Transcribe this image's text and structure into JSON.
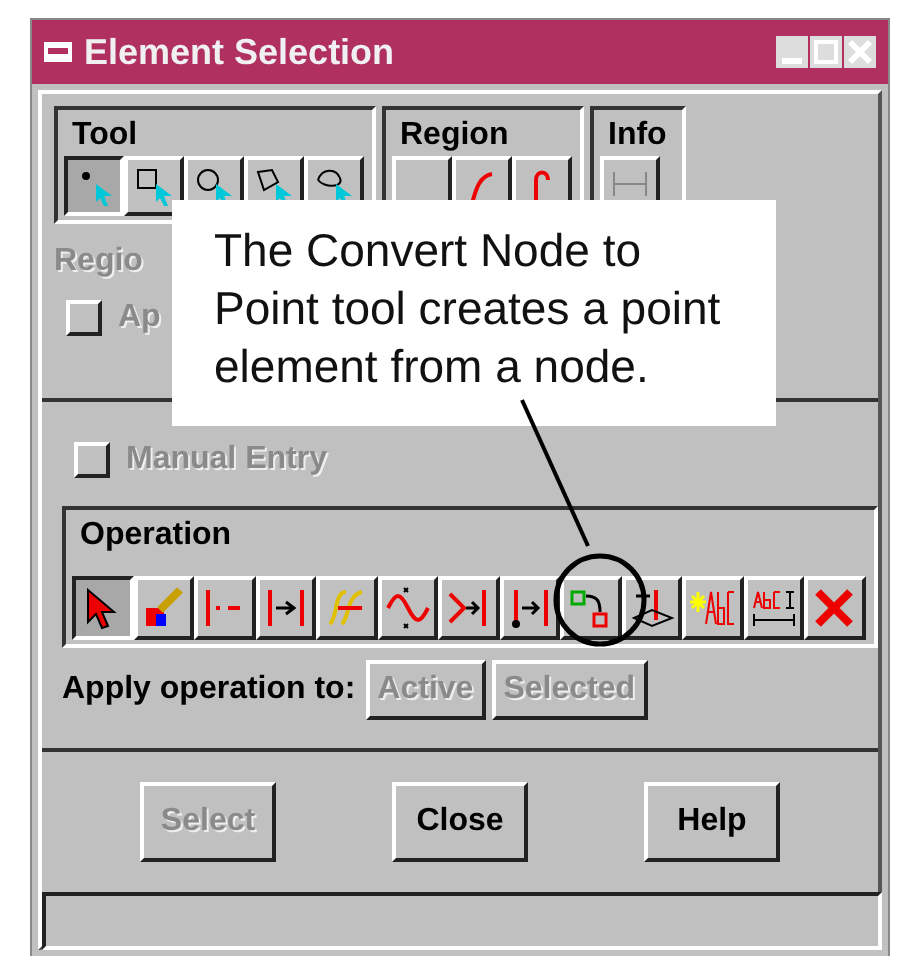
{
  "window": {
    "title": "Element Selection"
  },
  "tool_group": {
    "label": "Tool",
    "tools": [
      {
        "kind": "point",
        "selected": true
      },
      {
        "kind": "box",
        "selected": false
      },
      {
        "kind": "circle",
        "selected": false
      },
      {
        "kind": "polygon",
        "selected": false
      },
      {
        "kind": "freehand",
        "selected": false
      }
    ]
  },
  "region_group": {
    "label": "Region",
    "tools": [
      {
        "kind": "blank"
      },
      {
        "kind": "curve"
      },
      {
        "kind": "hook"
      }
    ]
  },
  "info_group": {
    "label": "Info"
  },
  "region_label": {
    "text": "Regio",
    "disabled": true
  },
  "apply_checkbox": {
    "label": "Ap",
    "checked": false,
    "disabled": true
  },
  "manual_entry": {
    "label": "Manual Entry",
    "checked": false,
    "disabled": true
  },
  "operation": {
    "label": "Operation",
    "tools": [
      {
        "kind": "select",
        "selected": true
      },
      {
        "kind": "paint",
        "selected": false
      },
      {
        "kind": "split",
        "selected": false
      },
      {
        "kind": "extend",
        "selected": false
      },
      {
        "kind": "curve",
        "selected": false
      },
      {
        "kind": "wave",
        "selected": false
      },
      {
        "kind": "join",
        "selected": false
      },
      {
        "kind": "connect",
        "selected": false
      },
      {
        "kind": "convert",
        "selected": false
      },
      {
        "kind": "project",
        "selected": false
      },
      {
        "kind": "label",
        "selected": false
      },
      {
        "kind": "dimension",
        "selected": false
      },
      {
        "kind": "delete",
        "selected": false
      }
    ]
  },
  "apply_to": {
    "label": "Apply operation to:",
    "buttons": [
      {
        "label": "Active",
        "disabled": true
      },
      {
        "label": "Selected",
        "disabled": true
      }
    ]
  },
  "buttons": [
    {
      "label": "Select",
      "disabled": true
    },
    {
      "label": "Close",
      "disabled": false
    },
    {
      "label": "Help",
      "disabled": false
    }
  ],
  "callout": {
    "lines": [
      "The Convert Node to",
      "Point tool creates a point",
      "element from a node."
    ]
  }
}
